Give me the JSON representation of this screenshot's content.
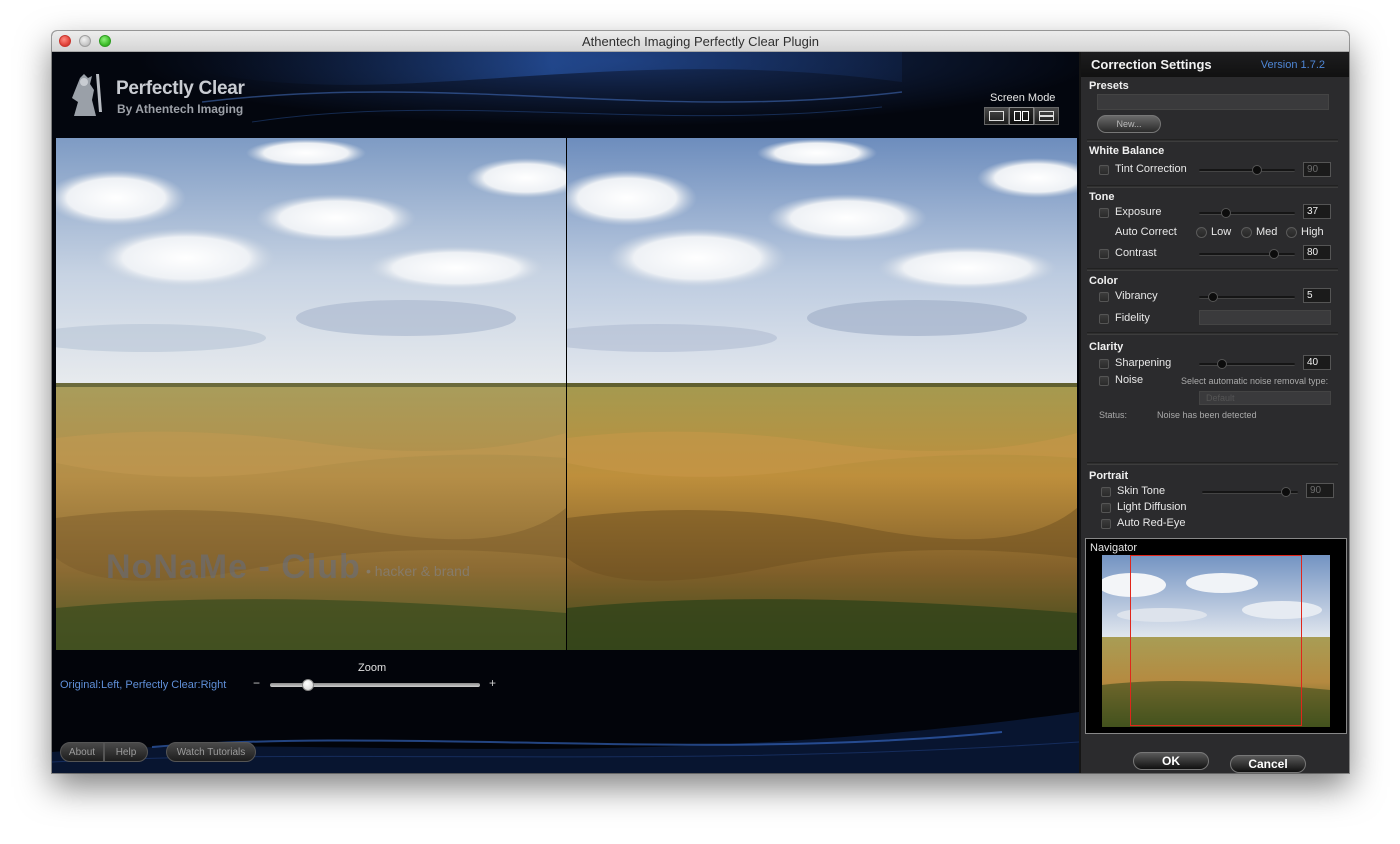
{
  "window": {
    "title": "Athentech Imaging Perfectly Clear Plugin"
  },
  "logo": {
    "title": "Perfectly Clear",
    "subtitle": "By Athentech Imaging"
  },
  "screen_mode": {
    "label": "Screen Mode",
    "options": [
      "single-view",
      "side-by-side",
      "split-view"
    ],
    "active_index": 1
  },
  "watermark": {
    "text": "NoNaMe - Club",
    "tagline": "• hacker & brand"
  },
  "zoom": {
    "label": "Zoom",
    "minus": "−",
    "plus": "+",
    "level": 0.18
  },
  "compare_label": "Original:Left, Perfectly Clear:Right",
  "footer": {
    "about": "About",
    "help": "Help",
    "tutorials": "Watch Tutorials"
  },
  "panel": {
    "title": "Correction Settings",
    "version": "Version 1.7.2",
    "presets": {
      "title": "Presets",
      "value": "",
      "new_button": "New..."
    },
    "white_balance": {
      "title": "White Balance",
      "tint": {
        "label": "Tint Correction",
        "value": "90",
        "level": 0.6,
        "checked": false,
        "enabled": false
      }
    },
    "tone": {
      "title": "Tone",
      "exposure": {
        "label": "Exposure",
        "value": "37",
        "level": 0.28
      },
      "auto_correct": {
        "label": "Auto Correct",
        "options": [
          "Low",
          "Med",
          "High"
        ]
      },
      "contrast": {
        "label": "Contrast",
        "value": "80",
        "level": 0.78
      }
    },
    "color": {
      "title": "Color",
      "vibrancy": {
        "label": "Vibrancy",
        "value": "5",
        "level": 0.15
      },
      "fidelity": {
        "label": "Fidelity"
      }
    },
    "clarity": {
      "title": "Clarity",
      "sharpening": {
        "label": "Sharpening",
        "value": "40",
        "level": 0.24
      },
      "noise": {
        "label": "Noise",
        "hint": "Select automatic noise removal type:",
        "dropdown": "Default"
      },
      "status_label": "Status:",
      "status_value": "Noise has been detected"
    },
    "portrait": {
      "title": "Portrait",
      "skin_tone": {
        "label": "Skin Tone",
        "value": "90",
        "level": 0.88
      },
      "light_diffusion": {
        "label": "Light Diffusion"
      },
      "auto_red_eye": {
        "label": "Auto Red-Eye"
      }
    },
    "navigator": {
      "title": "Navigator"
    },
    "ok": "OK",
    "cancel": "Cancel"
  },
  "colors": {
    "accent_blue": "#4e86d6",
    "nav_rect": "#e0261b"
  }
}
